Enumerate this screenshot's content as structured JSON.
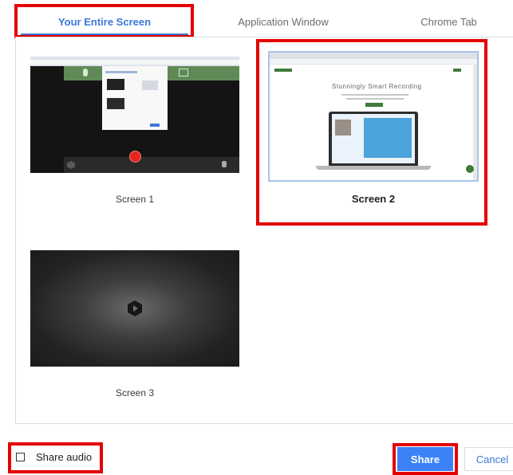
{
  "tabs": [
    {
      "label": "Your Entire Screen",
      "active": true
    },
    {
      "label": "Application Window",
      "active": false
    },
    {
      "label": "Chrome Tab",
      "active": false
    }
  ],
  "screens": [
    {
      "label": "Screen 1",
      "selected": false
    },
    {
      "label": "Screen 2",
      "selected": true,
      "hero_text": "Stunningly Smart Recording"
    },
    {
      "label": "Screen 3",
      "selected": false
    }
  ],
  "footer": {
    "share_audio_label": "Share audio",
    "share_audio_checked": false,
    "share_label": "Share",
    "cancel_label": "Cancel"
  },
  "colors": {
    "accent": "#3c78d8",
    "highlight": "#e30000",
    "share_button": "#3c82f6"
  }
}
